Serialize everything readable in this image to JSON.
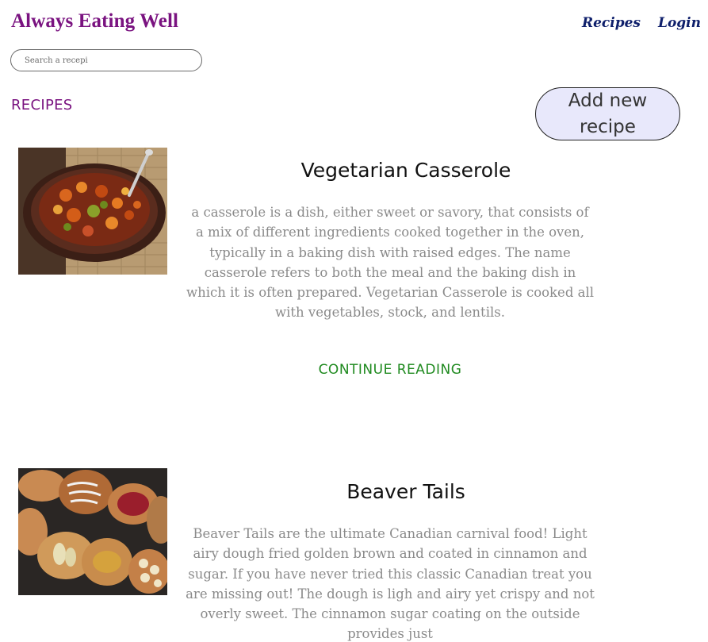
{
  "header": {
    "site_title": "Always Eating Well",
    "nav": [
      {
        "label": "Recipes"
      },
      {
        "label": "Login"
      }
    ]
  },
  "search": {
    "placeholder": "Search a recepi",
    "value": ""
  },
  "main": {
    "heading": "RECIPES",
    "add_button_label": "Add new recipe",
    "recipes": [
      {
        "title": "Vegetarian Casserole",
        "image": "casserole-photo",
        "description": "a casserole is a dish, either sweet or savory, that consists of a mix of different ingredients cooked together in the oven, typically in a baking dish with raised edges. The name casserole refers to both the meal and the baking dish in which it is often prepared. Vegetarian Casserole is cooked all with vegetables, stock, and lentils.",
        "link_label": "CONTINUE READING"
      },
      {
        "title": "Beaver Tails",
        "image": "beaver-tails-photo",
        "description": "Beaver Tails are the ultimate Canadian carnival food! Light airy dough fried golden brown and coated in cinnamon and sugar. If you have never tried this classic Canadian treat you are missing out! The dough is ligh and airy yet crispy and not overly sweet. The cinnamon sugar coating on the outside provides just"
      }
    ]
  },
  "colors": {
    "title": "#7a1380",
    "nav": "#0e1f6b",
    "link": "#1f8a1f",
    "button_bg": "#e8e8fb",
    "body_text": "#8a8a8a"
  }
}
